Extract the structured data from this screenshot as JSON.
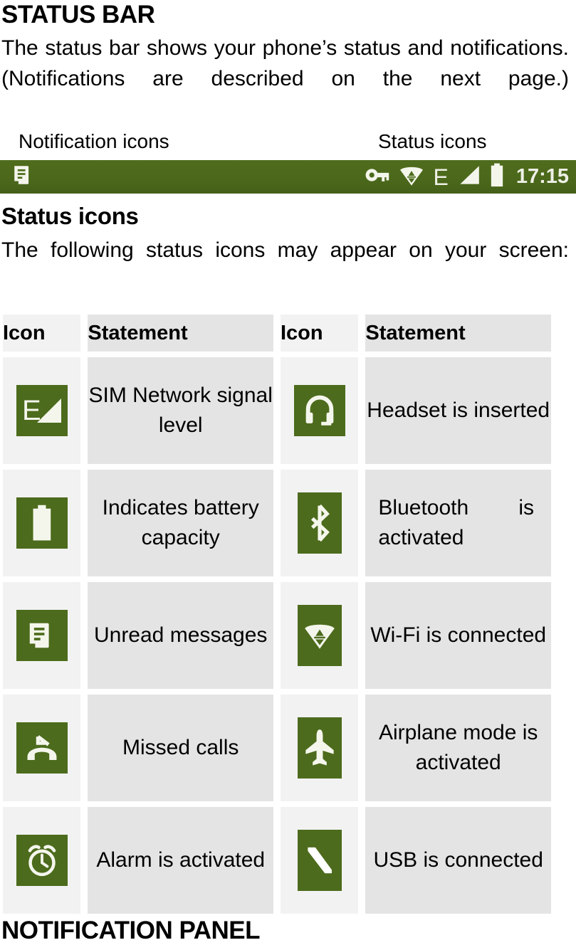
{
  "document": {
    "section_title": "STATUS BAR",
    "intro_paragraph": "The status bar shows your phone’s status and notifications. (Notifications are described on the next page.)",
    "subsection_title": "Status icons",
    "subsection_paragraph": "The following status icons may appear on your screen:",
    "bottom_heading": "NOTIFICATION PANEL"
  },
  "callouts": {
    "notification_icons_label": "Notification icons",
    "status_icons_label": "Status icons"
  },
  "status_bar": {
    "background_color": "#4c6b1c",
    "foreground_color": "#eef0e6",
    "time": "17:15",
    "notification_icons": [
      {
        "name": "message-icon",
        "glyph": "message"
      }
    ],
    "status_icons": [
      {
        "name": "key-icon",
        "glyph": "key"
      },
      {
        "name": "wifi-icon",
        "glyph": "wifi"
      },
      {
        "name": "edge-network-icon",
        "glyph": "E"
      },
      {
        "name": "signal-strength-icon",
        "glyph": "signal"
      },
      {
        "name": "battery-icon",
        "glyph": "battery"
      }
    ]
  },
  "table": {
    "headers": [
      "Icon",
      "Statement",
      "Icon",
      "Statement"
    ],
    "colors": {
      "icon_cell_bg": "#f2f2f2",
      "statement_cell_bg": "#e4e4e4",
      "tile_bg": "#4c6b1c"
    },
    "rows": [
      {
        "left": {
          "icon": "edge-signal-icon",
          "statement": "SIM Network signal level"
        },
        "right": {
          "icon": "headset-icon",
          "statement": "Headset is inserted"
        }
      },
      {
        "left": {
          "icon": "battery-icon",
          "statement": "Indicates battery capacity"
        },
        "right": {
          "icon": "bluetooth-icon",
          "statement": "Bluetooth is activated"
        }
      },
      {
        "left": {
          "icon": "message-icon",
          "statement": "Unread messages"
        },
        "right": {
          "icon": "wifi-icon",
          "statement": "Wi-Fi is connected"
        }
      },
      {
        "left": {
          "icon": "missed-call-icon",
          "statement": "Missed calls"
        },
        "right": {
          "icon": "airplane-icon",
          "statement": "Airplane mode is activated"
        }
      },
      {
        "left": {
          "icon": "alarm-clock-icon",
          "statement": "Alarm is activated"
        },
        "right": {
          "icon": "usb-icon",
          "statement": "USB is connected"
        }
      }
    ]
  }
}
